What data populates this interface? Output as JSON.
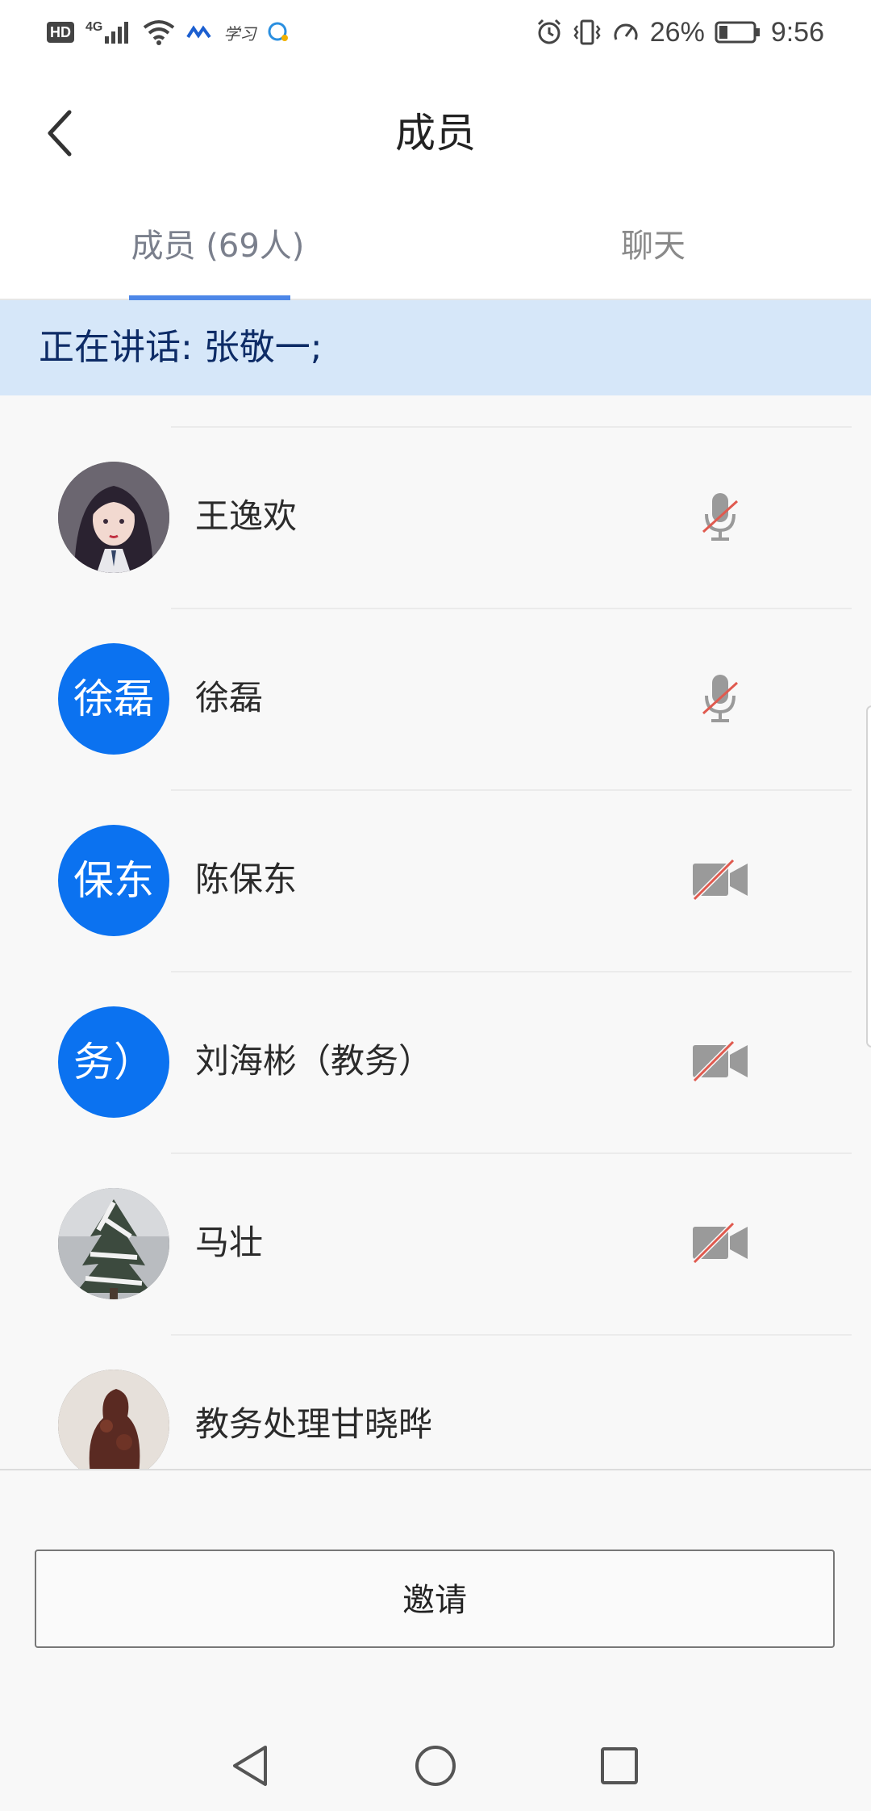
{
  "status_bar": {
    "hd_label": "HD",
    "network_label": "4G",
    "app_label": "学习",
    "battery_text": "26%",
    "battery_level": 0.26,
    "time": "9:56"
  },
  "header": {
    "title": "成员"
  },
  "tabs": [
    {
      "label": "成员 (69人)",
      "active": true
    },
    {
      "label": "聊天",
      "active": false
    }
  ],
  "speaking": {
    "text": "正在讲话: 张敬一;"
  },
  "members": [
    {
      "name": "王逸欢",
      "avatar_type": "photo",
      "avatar_icon": "anime-girl-avatar",
      "status_icon": "mic-muted-icon"
    },
    {
      "name": "徐磊",
      "avatar_type": "letters",
      "avatar_text": "徐磊",
      "status_icon": "mic-muted-icon"
    },
    {
      "name": "陈保东",
      "avatar_type": "letters",
      "avatar_text": "保东",
      "status_icon": "camera-off-icon"
    },
    {
      "name": "刘海彬（教务）",
      "avatar_type": "letters",
      "avatar_text": "务）",
      "status_icon": "camera-off-icon"
    },
    {
      "name": "马壮",
      "avatar_type": "photo",
      "avatar_icon": "snowy-tree-avatar",
      "status_icon": "camera-off-icon"
    },
    {
      "name": "教务处理甘晓晔",
      "avatar_type": "photo",
      "avatar_icon": "carving-avatar",
      "status_icon": ""
    }
  ],
  "invite": {
    "label": "邀请"
  },
  "colors": {
    "accent": "#4d87e8",
    "avatar_blue": "#0b72f0",
    "speaking_bg": "#d6e7f9",
    "speaking_text": "#0d2b66",
    "muted_red": "#e05a4f"
  }
}
